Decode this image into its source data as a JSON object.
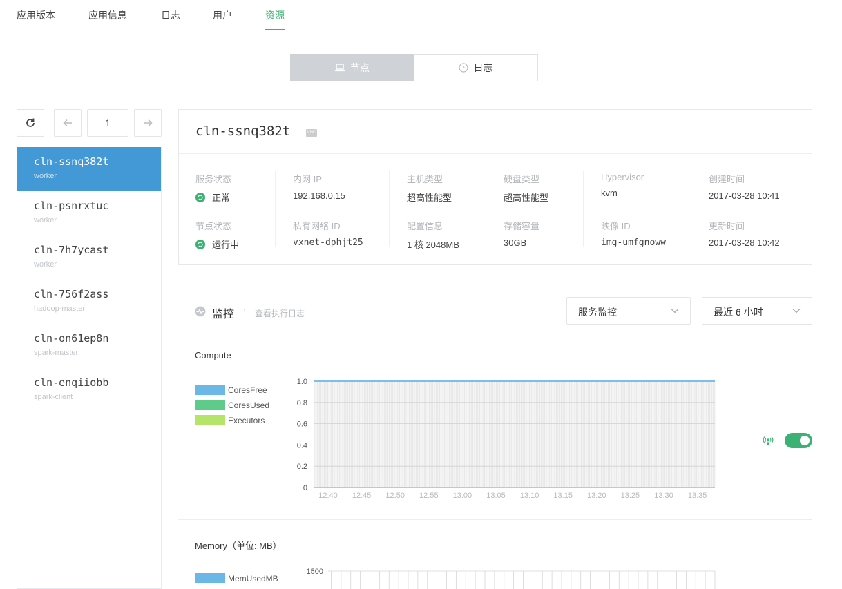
{
  "nav": {
    "tabs": [
      "应用版本",
      "应用信息",
      "日志",
      "用户",
      "资源"
    ]
  },
  "segment": {
    "nodes": "节点",
    "logs": "日志"
  },
  "pager": {
    "page": "1"
  },
  "nodes": [
    {
      "name": "cln-ssnq382t",
      "role": "worker"
    },
    {
      "name": "cln-psnrxtuc",
      "role": "worker"
    },
    {
      "name": "cln-7h7ycast",
      "role": "worker"
    },
    {
      "name": "cln-756f2ass",
      "role": "hadoop-master"
    },
    {
      "name": "cln-on61ep8n",
      "role": "spark-master"
    },
    {
      "name": "cln-enqiiobb",
      "role": "spark-client"
    }
  ],
  "detail": {
    "title": "cln-ssnq382t",
    "vnc": "VNC",
    "service_status_label": "服务状态",
    "service_status": "正常",
    "node_status_label": "节点状态",
    "node_status": "运行中",
    "ip_label": "内网 IP",
    "ip": "192.168.0.15",
    "vxnet_label": "私有网络 ID",
    "vxnet": "vxnet-dphjt25",
    "host_type_label": "主机类型",
    "host_type": "超高性能型",
    "config_label": "配置信息",
    "config": "1 核 2048MB",
    "disk_type_label": "硬盘类型",
    "disk_type": "超高性能型",
    "storage_label": "存储容量",
    "storage": "30GB",
    "hypervisor_label": "Hypervisor",
    "hypervisor": "kvm",
    "image_label": "映像 ID",
    "image": "img-umfgnoww",
    "created_label": "创建时间",
    "created": "2017-03-28 10:41",
    "updated_label": "更新时间",
    "updated": "2017-03-28 10:42"
  },
  "monitor": {
    "title": "监控",
    "link": "查看执行日志",
    "select1": "服务监控",
    "select2": "最近 6 小时"
  },
  "chart_data": [
    {
      "type": "line",
      "title": "Compute",
      "series": [
        {
          "name": "CoresFree",
          "color": "#6bb7e6",
          "y": 1
        },
        {
          "name": "CoresUsed",
          "color": "#5ecb8a",
          "y": 0
        },
        {
          "name": "Executors",
          "color": "#b4e46a",
          "y": 0
        }
      ],
      "x_ticks": [
        "12:40",
        "12:45",
        "12:50",
        "12:55",
        "13:00",
        "13:05",
        "13:10",
        "13:15",
        "13:20",
        "13:25",
        "13:30",
        "13:35"
      ],
      "y_ticks": [
        "0",
        "0.2",
        "0.4",
        "0.6",
        "0.8",
        "1.0"
      ],
      "ylim": [
        0,
        1.0
      ],
      "grid": true
    },
    {
      "type": "line",
      "title": "Memory（单位: MB）",
      "series": [
        {
          "name": "MemUsedMB",
          "color": "#6bb7e6"
        }
      ],
      "y_ticks": [
        "1500"
      ]
    }
  ],
  "colors": {
    "accent": "#3bb273",
    "selected": "#4399d5"
  }
}
